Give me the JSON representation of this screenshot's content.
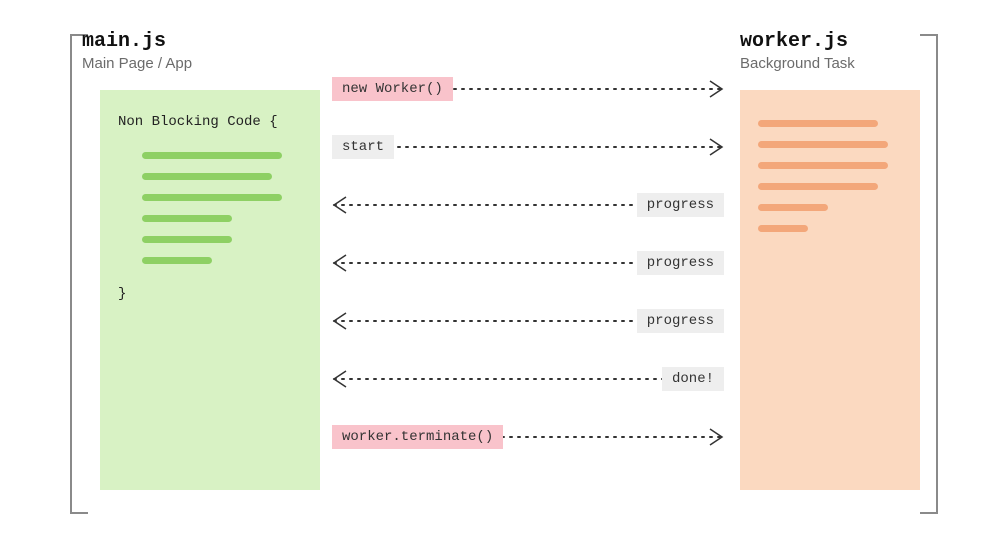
{
  "left_panel": {
    "title": "main.js",
    "subtitle": "Main Page / App",
    "code_open": "Non Blocking Code {",
    "code_close": "}",
    "line_widths": [
      140,
      130,
      140,
      90,
      90,
      70
    ]
  },
  "right_panel": {
    "title": "worker.js",
    "subtitle": "Background Task",
    "line_widths": [
      120,
      130,
      130,
      120,
      70,
      50
    ]
  },
  "messages": [
    {
      "label": "new Worker()",
      "side": "left",
      "direction": "right",
      "pink": true
    },
    {
      "label": "start",
      "side": "left",
      "direction": "right",
      "pink": false
    },
    {
      "label": "progress",
      "side": "right",
      "direction": "left",
      "pink": false
    },
    {
      "label": "progress",
      "side": "right",
      "direction": "left",
      "pink": false
    },
    {
      "label": "progress",
      "side": "right",
      "direction": "left",
      "pink": false
    },
    {
      "label": "done!",
      "side": "right",
      "direction": "left",
      "pink": false
    },
    {
      "label": "worker.terminate()",
      "side": "left",
      "direction": "right",
      "pink": true
    }
  ]
}
